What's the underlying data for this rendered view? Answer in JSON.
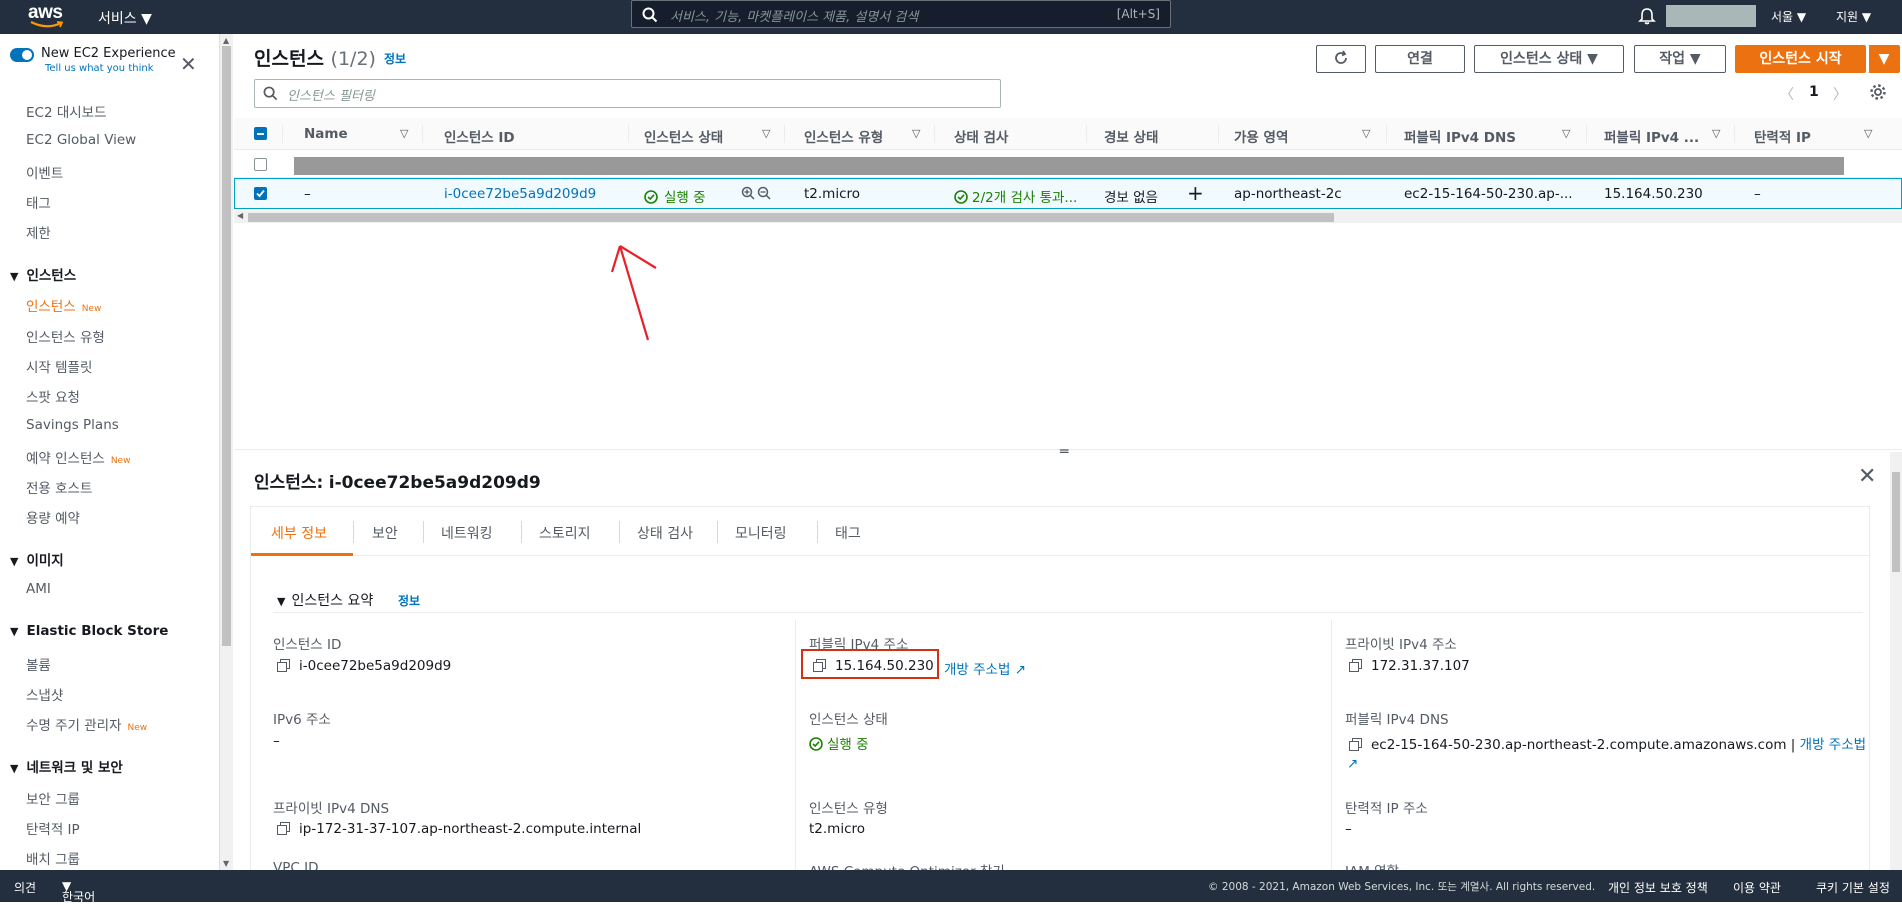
{
  "topbar": {
    "logo": "aws",
    "services": "서비스",
    "search_placeholder": "서비스, 기능, 마켓플레이스 제품, 설명서 검색",
    "search_shortcut": "[Alt+S]",
    "region": "서울",
    "support": "지원"
  },
  "sidebar": {
    "new_experience": "New EC2 Experience",
    "tell_us": "Tell us what you think",
    "top_items": [
      "EC2 대시보드",
      "EC2 Global View",
      "이벤트",
      "태그",
      "제한"
    ],
    "sections": [
      {
        "title": "인스턴스",
        "items": [
          "인스턴스",
          "인스턴스 유형",
          "시작 템플릿",
          "스팟 요청",
          "Savings Plans",
          "예약 인스턴스",
          "전용 호스트",
          "용량 예약"
        ]
      },
      {
        "title": "이미지",
        "items": [
          "AMI"
        ]
      },
      {
        "title": "Elastic Block Store",
        "items": [
          "볼륨",
          "스냅샷",
          "수명 주기 관리자"
        ]
      },
      {
        "title": "네트워크 및 보안",
        "items": [
          "보안 그룹",
          "탄력적 IP",
          "배치 그룹"
        ]
      }
    ],
    "new_badge": "New"
  },
  "header": {
    "title": "인스턴스",
    "count": "(1/2)",
    "info": "정보",
    "connect": "연결",
    "instance_state": "인스턴스 상태",
    "actions": "작업",
    "launch": "인스턴스 시작",
    "filter_placeholder": "인스턴스 필터링",
    "page": "1"
  },
  "table": {
    "columns": [
      "Name",
      "인스턴스 ID",
      "인스턴스 상태",
      "인스턴스 유형",
      "상태 검사",
      "경보 상태",
      "가용 영역",
      "퍼블릭 IPv4 DNS",
      "퍼블릭 IPv4 ...",
      "탄력적 IP"
    ],
    "row": {
      "name": "–",
      "id": "i-0cee72be5a9d209d9",
      "state": "실행 중",
      "type": "t2.micro",
      "check": "2/2개 검사 통과...",
      "alarm": "경보 없음",
      "az": "ap-northeast-2c",
      "dns": "ec2-15-164-50-230.ap-...",
      "ip": "15.164.50.230",
      "eip": "–"
    }
  },
  "details": {
    "title_prefix": "인스턴스:",
    "title_id": "i-0cee72be5a9d209d9",
    "tabs": [
      "세부 정보",
      "보안",
      "네트워킹",
      "스토리지",
      "상태 검사",
      "모니터링",
      "태그"
    ],
    "summary": "인스턴스 요약",
    "summary_info": "정보",
    "instance_id_label": "인스턴스 ID",
    "instance_id": "i-0cee72be5a9d209d9",
    "ipv6_label": "IPv6 주소",
    "ipv6": "–",
    "private_dns_label": "프라이빗 IPv4 DNS",
    "private_dns": "ip-172-31-37-107.ap-northeast-2.compute.internal",
    "vpc_label": "VPC ID",
    "public_ip_label": "퍼블릭 IPv4 주소",
    "public_ip": "15.164.50.230",
    "open_address": "개방 주소법",
    "state_label": "인스턴스 상태",
    "state": "실행 중",
    "type_label": "인스턴스 유형",
    "type": "t2.micro",
    "optimizer_label": "AWS Compute Optimizer 찾기",
    "private_ip_label": "프라이빗 IPv4 주소",
    "private_ip": "172.31.37.107",
    "public_dns_label": "퍼블릭 IPv4 DNS",
    "public_dns": "ec2-15-164-50-230.ap-northeast-2.compute.amazonaws.com",
    "public_dns_sep": "|",
    "elastic_label": "탄력적 IP 주소",
    "elastic": "–",
    "iam_label": "IAM 역할"
  },
  "footer": {
    "feedback": "의견",
    "language": "한국어",
    "copyright": "© 2008 - 2021, Amazon Web Services, Inc. 또는 계열사. All rights reserved.",
    "privacy": "개인 정보 보호 정책",
    "terms": "이용 약관",
    "cookies": "쿠키 기본 설정"
  },
  "colors": {
    "accent": "#ec7211",
    "link": "#0073bb",
    "nav": "#232f3e",
    "ok": "#1d8102",
    "highlight": "#d13212"
  }
}
